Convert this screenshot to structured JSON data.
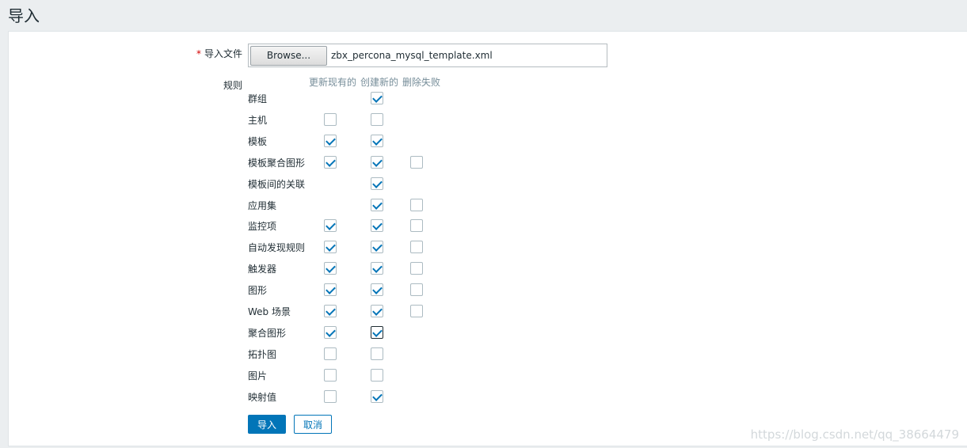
{
  "page": {
    "title": "导入"
  },
  "form": {
    "file_label": "导入文件",
    "required_mark": "*",
    "browse_label": "Browse...",
    "file_name": "zbx_percona_mysql_template.xml",
    "rules_label": "规则",
    "columns": [
      "更新现有的",
      "创建新的",
      "删除失败"
    ]
  },
  "rules": [
    {
      "label": "群组",
      "update": null,
      "create": true,
      "delete": null
    },
    {
      "label": "主机",
      "update": false,
      "create": false,
      "delete": null
    },
    {
      "label": "模板",
      "update": true,
      "create": true,
      "delete": null
    },
    {
      "label": "模板聚合图形",
      "update": true,
      "create": true,
      "delete": false
    },
    {
      "label": "模板间的关联",
      "update": null,
      "create": true,
      "delete": null
    },
    {
      "label": "应用集",
      "update": null,
      "create": true,
      "delete": false
    },
    {
      "label": "监控项",
      "update": true,
      "create": true,
      "delete": false
    },
    {
      "label": "自动发现规则",
      "update": true,
      "create": true,
      "delete": false
    },
    {
      "label": "触发器",
      "update": true,
      "create": true,
      "delete": false
    },
    {
      "label": "图形",
      "update": true,
      "create": true,
      "delete": false
    },
    {
      "label": "Web 场景",
      "update": true,
      "create": true,
      "delete": false
    },
    {
      "label": "聚合图形",
      "update": true,
      "create": true,
      "delete": null
    },
    {
      "label": "拓扑图",
      "update": false,
      "create": false,
      "delete": null
    },
    {
      "label": "图片",
      "update": false,
      "create": false,
      "delete": null
    },
    {
      "label": "映射值",
      "update": false,
      "create": true,
      "delete": null
    }
  ],
  "buttons": {
    "import": "导入",
    "cancel": "取消"
  },
  "watermark": "https://blog.csdn.net/qq_38664479",
  "colors": {
    "accent": "#0275b8",
    "background": "#ebeef0"
  }
}
